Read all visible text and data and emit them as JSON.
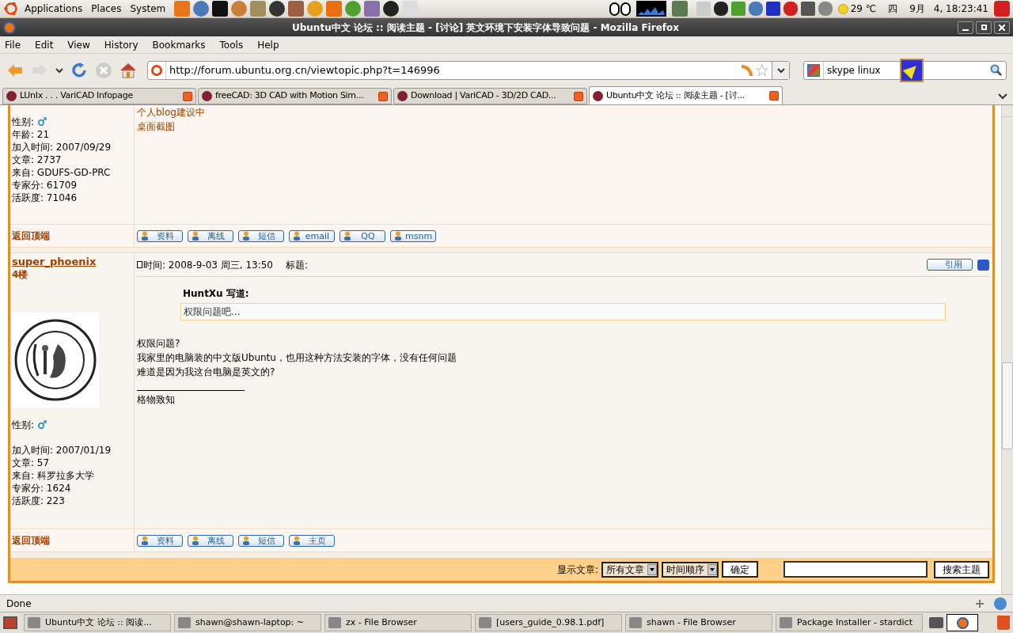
{
  "top_panel": {
    "menus": [
      "Applications",
      "Places",
      "System"
    ],
    "weather": "29 ℃",
    "weekday": "四",
    "month": "9月",
    "datetime": "4, 18:23:41"
  },
  "window": {
    "title": "Ubuntu中文 论坛 :: 阅读主题 - [讨论] 英文环境下安装字体导致问题 - Mozilla Firefox"
  },
  "menu": [
    "File",
    "Edit",
    "View",
    "History",
    "Bookmarks",
    "Tools",
    "Help"
  ],
  "toolbar": {
    "url": "http://forum.ubuntu.org.cn/viewtopic.php?t=146996",
    "search": "skype linux"
  },
  "tabs": [
    {
      "label": "LUnIx . . . VariCAD Infopage",
      "selected": false
    },
    {
      "label": "freeCAD: 3D CAD with Motion Sim...",
      "selected": false
    },
    {
      "label": "Download | VariCAD - 3D/2D CAD...",
      "selected": false
    },
    {
      "label": "Ubuntu中文 论坛 :: 阅读主题 - [讨...",
      "selected": true
    }
  ],
  "posts": [
    {
      "profile": [
        "年龄: 21",
        "加入时间: 2007/09/29",
        "文章: 2737",
        "来自: GDUFS-GD-PRC",
        "专家分: 61709",
        "活跃度: 71046"
      ],
      "gender_label": "性别:",
      "signature_links": [
        "个人blog建设中",
        "桌面截图"
      ],
      "back_to_top": "返回顶端",
      "actions": [
        "资料",
        "离线",
        "短信",
        "email",
        "QQ",
        "msnm"
      ]
    },
    {
      "author": "super_phoenix",
      "floor": "4楼",
      "time": "时间: 2008-9-03 周三, 13:50",
      "subject_label": "标题:",
      "quote_button": "引用",
      "quote_author": "HuntXu 写道:",
      "quote_text": "权限问题吧...",
      "body": [
        "权限问题?",
        "我家里的电脑装的中文版Ubuntu，也用这种方法安装的字体，没有任何问题",
        "难道是因为我这台电脑是英文的?"
      ],
      "signature": "格物致知",
      "gender_label": "性别:",
      "profile": [
        "加入时间: 2007/01/19",
        "文章: 57",
        "来自: 科罗拉多大学",
        "专家分: 1624",
        "活跃度: 223"
      ],
      "back_to_top": "返回顶端",
      "actions": [
        "资料",
        "离线",
        "短信",
        "主页"
      ]
    }
  ],
  "footer": {
    "label": "显示文章:",
    "selects": [
      "所有文章",
      "时间顺序"
    ],
    "confirm": "确定",
    "search_button": "搜索主题"
  },
  "status": "Done",
  "taskbar": [
    "Ubuntu中文 论坛 :: 阅读...",
    "shawn@shawn-laptop: ~",
    "zx - File Browser",
    "[users_guide_0.98.1.pdf]",
    "shawn - File Browser",
    "Package Installer - stardict"
  ]
}
